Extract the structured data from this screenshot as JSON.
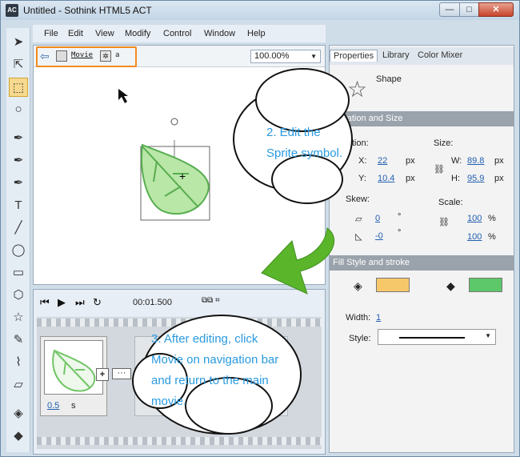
{
  "window": {
    "title": "Untitled - Sothink HTML5 ACT",
    "app_icon": "AC"
  },
  "menu": [
    "File",
    "Edit",
    "View",
    "Modify",
    "Control",
    "Window",
    "Help"
  ],
  "navbar": {
    "movie_label": "Movie",
    "symbol_label": "a",
    "zoom": "100.00%"
  },
  "timeline": {
    "time": "00:01.500",
    "frame_duration": "0.5",
    "frame_unit": "s"
  },
  "panel": {
    "tabs": [
      "Properties",
      "Library",
      "Color Mixer"
    ],
    "shape_label": "Shape",
    "loc_section": "Location and Size",
    "location_label": "Location:",
    "size_label": "Size:",
    "x_label": "X:",
    "x_value": "22",
    "y_label": "Y:",
    "y_value": "10.4",
    "w_label": "W:",
    "w_value": "89.8",
    "h_label": "H:",
    "h_value": "95.9",
    "px": "px",
    "skew_label": "Skew:",
    "skew1": "0",
    "skew2": "-0",
    "scale_label": "Scale:",
    "scale1": "100",
    "scale2": "100",
    "pct": "%",
    "degree": "°",
    "fill_section": "Fill Style and stroke",
    "width_label": "Width:",
    "width_value": "1",
    "style_label": "Style:",
    "fill_color": "#f7c86a",
    "stroke_color": "#5cc86a"
  },
  "callouts": {
    "step2": "2. Edit the Sprite symbol.",
    "step3": "3. After editing, click Movie on navigation bar and return to the main movie."
  }
}
